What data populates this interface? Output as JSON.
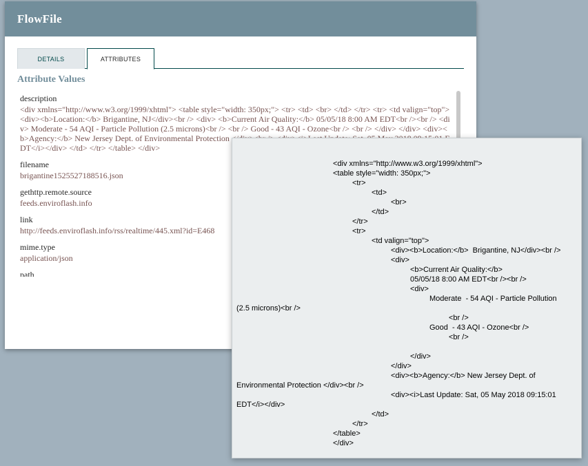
{
  "dialog": {
    "title": "FlowFile",
    "tabs": [
      "DETAILS",
      "ATTRIBUTES"
    ],
    "active_tab": "ATTRIBUTES",
    "section_title": "Attribute Values",
    "attributes": [
      {
        "name": "description",
        "value": "<div xmlns=\"http://www.w3.org/1999/xhtml\"> <table style=\"width: 350px;\"> <tr> <td> <br> </td> </tr> <tr> <td valign=\"top\"> <div><b>Location:</b> Brigantine, NJ</div><br /> <div> <b>Current Air Quality:</b> 05/05/18 8:00 AM EDT<br /><br /> <div> Moderate - 54 AQI - Particle Pollution (2.5 microns)<br /> <br /> Good - 43 AQI - Ozone<br /> <br /> </div> </div> <div><b>Agency:</b> New Jersey Dept. of Environmental Protection </div><br /> <div><i>Last Update: Sat, 05 May 2018 09:15:01 EDT</i></div> </td> </tr> </table> </div>"
      },
      {
        "name": "filename",
        "value": "brigantine1525527188516.json"
      },
      {
        "name": "gethttp.remote.source",
        "value": "feeds.enviroflash.info"
      },
      {
        "name": "link",
        "value": "http://feeds.enviroflash.info/rss/realtime/445.xml?id=E468"
      },
      {
        "name": "mime.type",
        "value": "application/json"
      },
      {
        "name": "path",
        "value": ""
      }
    ]
  },
  "popup": {
    "lines": [
      "<div xmlns=\"http://www.w3.org/1999/xhtml\">",
      "<table style=\"width: 350px;\">",
      "<tr>",
      "<td>",
      "<br>",
      "</td>",
      "</tr>",
      "<tr>",
      "<td valign=\"top\">",
      "<div><b>Location:</b>  Brigantine, NJ</div><br />",
      "<div>",
      "<b>Current Air Quality:</b>",
      "05/05/18 8:00 AM EDT<br /><br />",
      "<div>",
      "Moderate  - 54 AQI - Particle Pollution",
      "(2.5 microns)<br />",
      "<br />",
      "Good  - 43 AQI - Ozone<br />",
      "<br />",
      "</div>",
      "</div>",
      "<div><b>Agency:</b> New Jersey Dept. of",
      "Environmental Protection </div><br />",
      "<div><i>Last Update: Sat, 05 May 2018 09:15:01",
      "EDT</i></div>",
      "</td>",
      "</tr>",
      "</table>",
      "</div>"
    ]
  }
}
